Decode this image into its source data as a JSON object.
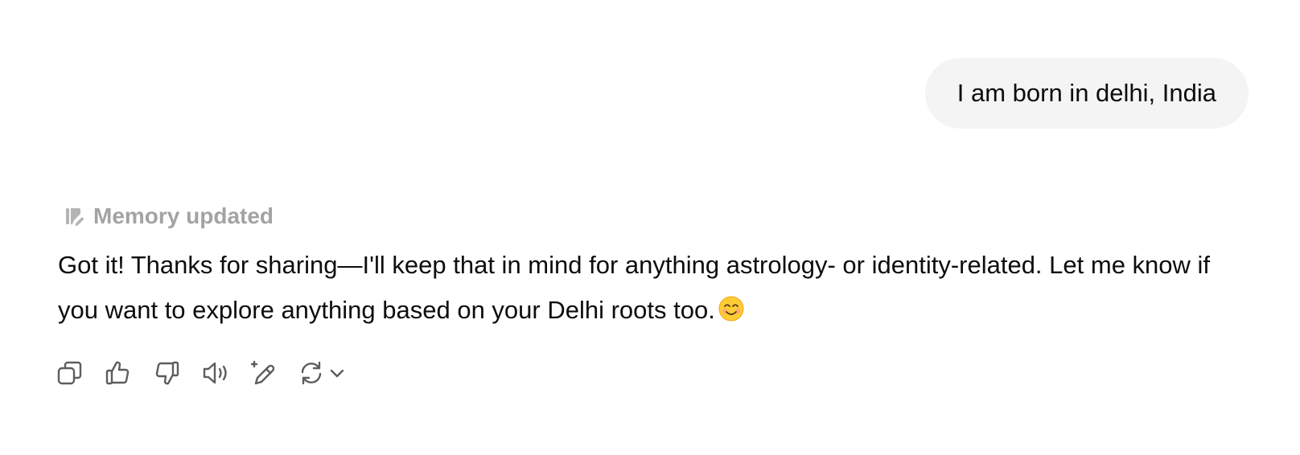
{
  "conversation": {
    "user_message": "I am born in delhi, India",
    "memory_status": "Memory updated",
    "assistant_reply": "Got it! Thanks for sharing—I'll keep that in mind for anything astrology- or identity-related. Let me know if you want to explore anything based on your Delhi roots too."
  },
  "icons": {
    "memory": "memory-pencil-icon",
    "emoji": "smiling-face-emoji",
    "actions": [
      "copy-icon",
      "thumbs-up-icon",
      "thumbs-down-icon",
      "read-aloud-icon",
      "edit-sparkle-icon",
      "regenerate-icon",
      "chevron-down-icon"
    ]
  },
  "colors": {
    "user_bubble_bg": "#f4f4f4",
    "text_primary": "#0d0d0d",
    "memory_text": "#a3a3a3",
    "icon_stroke": "#5d5d5d"
  }
}
